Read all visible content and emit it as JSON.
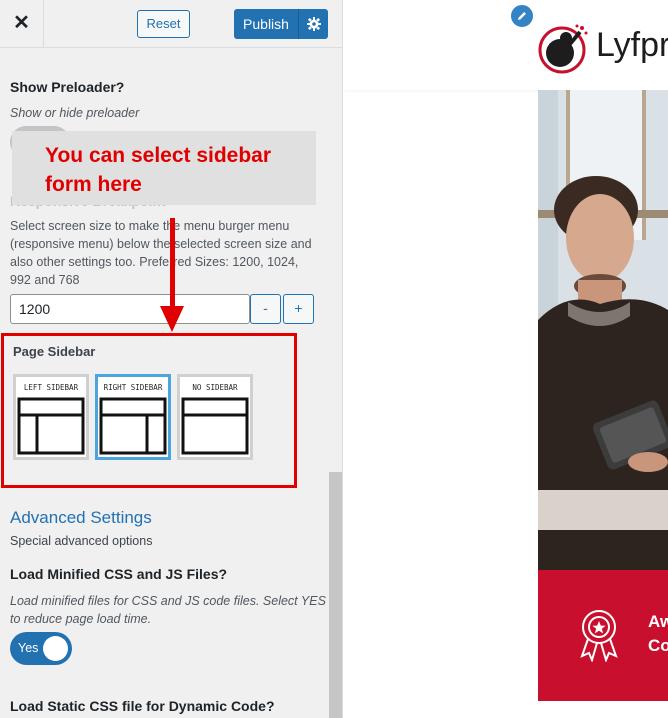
{
  "header": {
    "close_icon": "close-icon",
    "reset_label": "Reset",
    "publish_label": "Publish",
    "gear_icon": "gear-icon"
  },
  "preloader": {
    "title": "Show Preloader?",
    "description": "Show or hide preloader"
  },
  "annotation": {
    "line1": "You can select sidebar",
    "line2": "form here",
    "color": "#e10000"
  },
  "responsive": {
    "title_partial": "Responsive Breakpoint",
    "desc_lines": [
      "Select screen size to make the menu burger menu",
      "(responsive menu) below the selected screen size and",
      "also other settings too. Preferred Sizes: 1200, 1024,",
      "992 and 768"
    ],
    "value": "1200",
    "minus": "-",
    "plus": "+"
  },
  "page_sidebar": {
    "title": "Page Sidebar",
    "options": [
      {
        "label": "LEFT SIDEBAR",
        "selected": false
      },
      {
        "label": "RIGHT SIDEBAR",
        "selected": true
      },
      {
        "label": "NO SIDEBAR",
        "selected": false
      }
    ]
  },
  "advanced": {
    "title": "Advanced Settings",
    "description": "Special advanced options"
  },
  "minified": {
    "title": "Load Minified CSS and JS Files?",
    "desc_line1": "Load minified files for CSS and JS code files. Select YES",
    "desc_line2": "to reduce page load time.",
    "toggle_label": "Yes"
  },
  "static_css": {
    "title": "Load Static CSS file for Dynamic Code?"
  },
  "preview": {
    "logo_text": "Lyfpr",
    "banner_line1": "Aw",
    "banner_line2": "Co",
    "brand_color": "#c8102e",
    "accent_color": "#2271b1"
  }
}
